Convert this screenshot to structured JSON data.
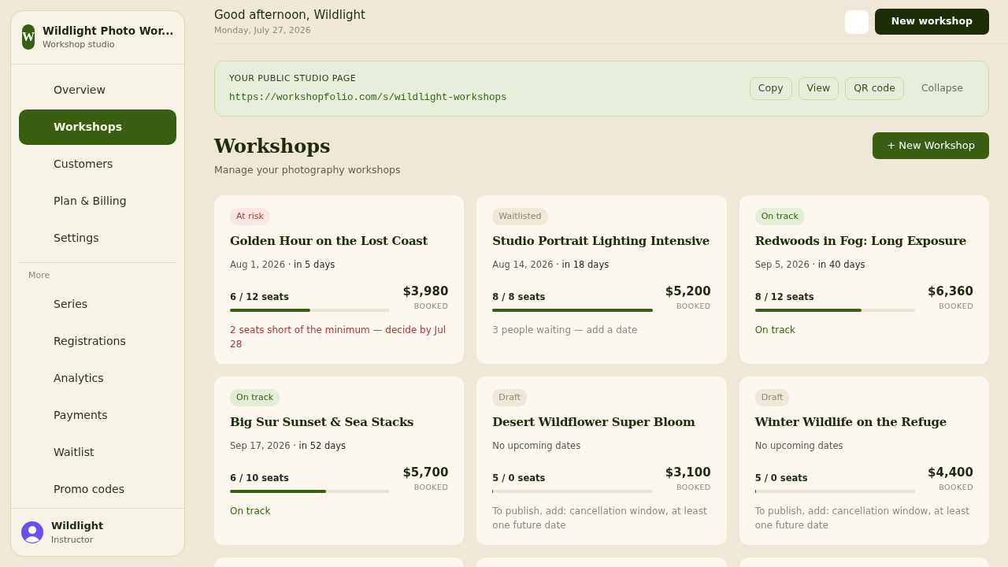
{
  "sidebar": {
    "brand": {
      "initial": "W",
      "name": "Wildlight Photo Wor...",
      "subtitle": "Workshop studio"
    },
    "items": [
      {
        "label": "Overview",
        "selected": false
      },
      {
        "label": "Workshops",
        "selected": true
      },
      {
        "label": "Customers",
        "selected": false
      },
      {
        "label": "Plan & Billing",
        "selected": false
      },
      {
        "label": "Settings",
        "selected": false
      }
    ],
    "section_label": "More",
    "more_items": [
      {
        "label": "Series",
        "selected": false
      },
      {
        "label": "Registrations",
        "selected": false
      },
      {
        "label": "Analytics",
        "selected": false
      },
      {
        "label": "Payments",
        "selected": false
      },
      {
        "label": "Waitlist",
        "selected": false
      },
      {
        "label": "Promo codes",
        "selected": false
      }
    ],
    "user": {
      "name": "Wildlight",
      "role": "Instructor"
    }
  },
  "header": {
    "greeting": "Good afternoon, Wildlight",
    "date": "Monday, July 27, 2026",
    "new_button": "New workshop"
  },
  "studio_page": {
    "label": "YOUR PUBLIC STUDIO PAGE",
    "url": "https://workshopfolio.com/s/wildlight-workshops",
    "actions": [
      "Copy",
      "View",
      "QR code"
    ],
    "collapse": "Collapse"
  },
  "page": {
    "title": "Workshops",
    "subtitle": "Manage your photography workshops",
    "add_button": "+ New Workshop"
  },
  "workshops": [
    {
      "status": "At risk",
      "kind": "at_risk",
      "title": "Golden Hour on the Lost Coast",
      "date": "Aug 1, 2026",
      "relative": "· in 5 days",
      "seats": "6 / 12 seats",
      "level": 0.5,
      "amount": "$3,980",
      "amount_label": "BOOKED",
      "note": "2 seats short of the minimum — decide by Jul 28"
    },
    {
      "status": "Waitlisted",
      "kind": "waitlisted",
      "title": "Studio Portrait Lighting Intensive",
      "date": "Aug 14, 2026",
      "relative": "· in 18 days",
      "seats": "8 / 8 seats",
      "level": 1,
      "amount": "$5,200",
      "amount_label": "BOOKED",
      "note": "3 people waiting — add a date"
    },
    {
      "status": "On track",
      "kind": "on_track",
      "title": "Redwoods in Fog: Long Exposure",
      "date": "Sep 5, 2026",
      "relative": "· in 40 days",
      "seats": "8 / 12 seats",
      "level": 0.667,
      "amount": "$6,360",
      "amount_label": "BOOKED",
      "note": "On track"
    },
    {
      "status": "On track",
      "kind": "on_track",
      "title": "Big Sur Sunset & Sea Stacks",
      "date": "Sep 17, 2026",
      "relative": "· in 52 days",
      "seats": "6 / 10 seats",
      "level": 0.6,
      "amount": "$5,700",
      "amount_label": "BOOKED",
      "note": "On track"
    },
    {
      "status": "Draft",
      "kind": "draft",
      "title": "Desert Wildflower Super Bloom",
      "date": "No upcoming dates",
      "seats": "5 / 0 seats",
      "level": 0,
      "amount": "$3,100",
      "amount_label": "BOOKED",
      "note": "To publish, add: cancellation window, at least one future date"
    },
    {
      "status": "Draft",
      "kind": "draft",
      "title": "Winter Wildlife on the Refuge",
      "date": "No upcoming dates",
      "seats": "5 / 0 seats",
      "level": 0,
      "amount": "$4,400",
      "amount_label": "BOOKED",
      "note": "To publish, add: cancellation window, at least one future date"
    },
    {
      "kind": "cut_off"
    },
    {
      "kind": "cut_off"
    },
    {
      "kind": "cut_off"
    }
  ]
}
